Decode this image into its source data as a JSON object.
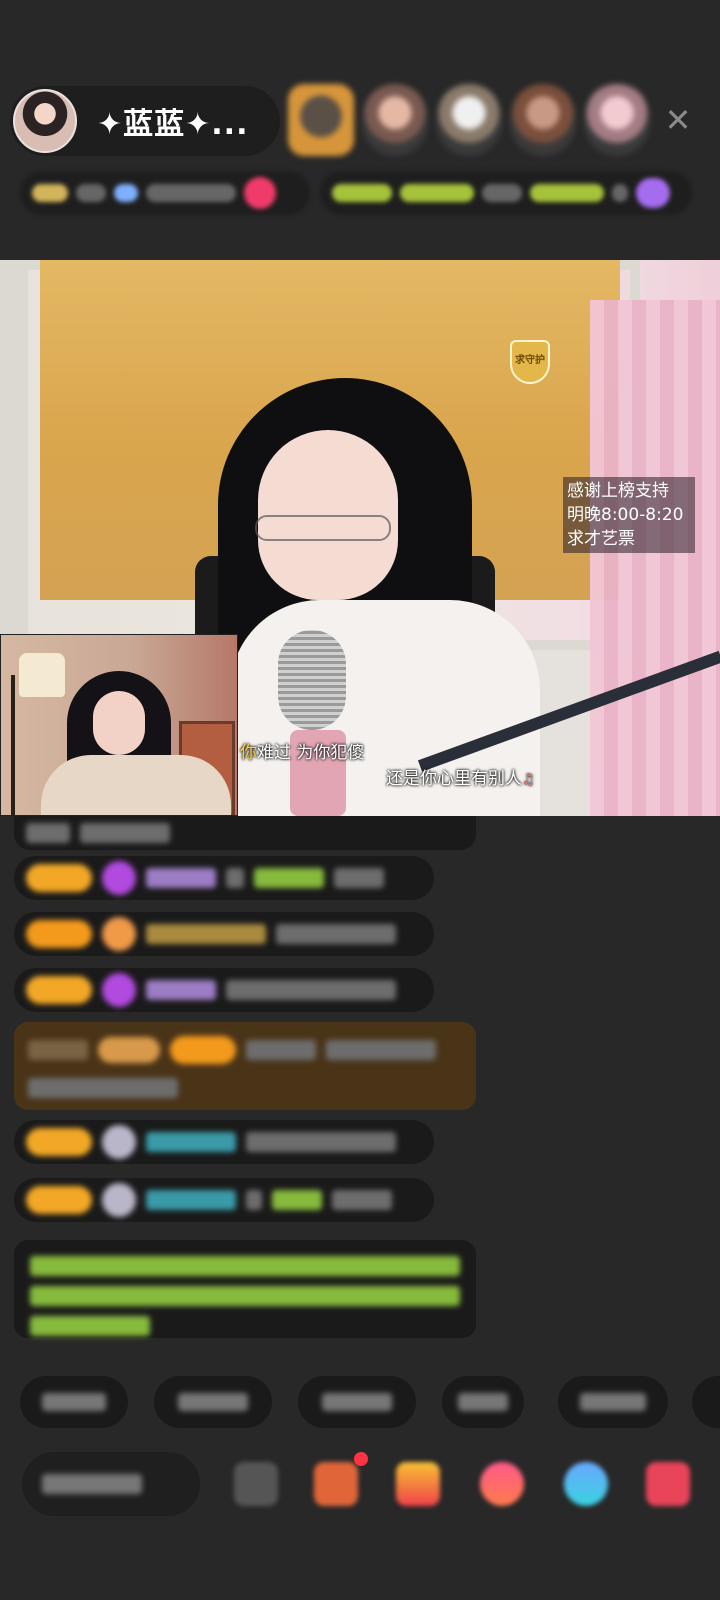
{
  "header": {
    "host_name": "✦蓝蓝✦...",
    "close_glyph": "✕"
  },
  "video": {
    "badge_text": "求守护",
    "note_lines": [
      "感谢上榜支持",
      "明晚8:00-8:20",
      "求才艺票"
    ],
    "lyric_1": {
      "text": "你难过  为你犯傻",
      "accent_first_char": "你"
    },
    "lyric_2": {
      "text": "还是你心里有别人",
      "tail_mark": "♫"
    }
  },
  "colors": {
    "background": "#282828",
    "level_badge": "#f2a826",
    "special_message_bg": "#4a3418",
    "green_text": "#86ba3c",
    "notification_dot": "#ff3344"
  },
  "icons": {
    "close": "close-icon",
    "gift": "gift-icon",
    "emoji": "emoji-icon",
    "share": "share-icon",
    "game": "game-icon",
    "more": "more-icon"
  }
}
